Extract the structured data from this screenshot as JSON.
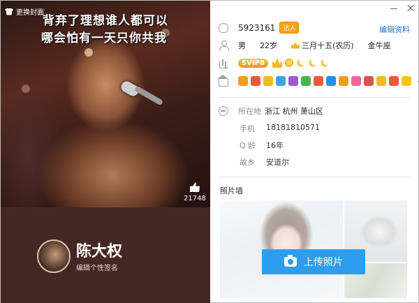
{
  "cover": {
    "change_label": "更换封面",
    "lyric_line1": "背弃了理想谁人都可以",
    "lyric_line2": "哪会怕有一天只你共我",
    "like_count": "21748"
  },
  "profile": {
    "nickname": "陈大权",
    "signature_placeholder": "编辑个性签名"
  },
  "header": {
    "qq_number": "5923161",
    "badge_label": "达人",
    "edit_profile": "编辑资料"
  },
  "basic": {
    "gender": "男",
    "age": "22岁",
    "birthday": "三月十五(农历)",
    "zodiac": "金牛座"
  },
  "level": {
    "svip_label": "SVIP8",
    "icons": [
      "crown-icon",
      "sun-icon",
      "moon-icon",
      "moon-icon",
      "moon-icon"
    ]
  },
  "badges": {
    "colors": [
      "#f29c1f",
      "#e8593f",
      "#f5b926",
      "#3aa6e8",
      "#9b59d0",
      "#4cb54b",
      "#e8593f",
      "#2d8de0",
      "#f29c1f",
      "#e86a9a",
      "#d9534f",
      "#f5b926",
      "#e8593f",
      "#f5c518"
    ]
  },
  "details": {
    "location_label": "所在地",
    "location_value": "浙江 杭州 萧山区",
    "phone_label": "手机",
    "phone_value": "18181810571",
    "qage_label": "Q 龄",
    "qage_value": "16年",
    "hometown_label": "故乡",
    "hometown_value": "安道尔"
  },
  "photo_wall": {
    "title": "照片墙",
    "upload_label": "上传照片"
  }
}
